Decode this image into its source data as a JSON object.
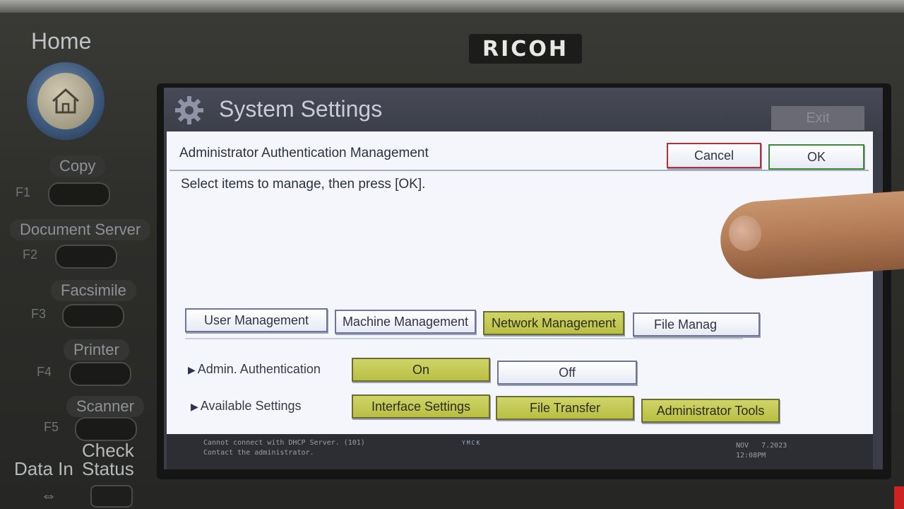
{
  "device": {
    "brand": "RICOH",
    "home_label": "Home",
    "modes": [
      {
        "label": "Copy",
        "fkey": "F1"
      },
      {
        "label": "Document Server",
        "fkey": "F2"
      },
      {
        "label": "Facsimile",
        "fkey": "F3"
      },
      {
        "label": "Printer",
        "fkey": "F4"
      },
      {
        "label": "Scanner",
        "fkey": "F5"
      }
    ],
    "data_in_label": "Data In",
    "check_status_label": "Check Status"
  },
  "screen": {
    "title": "System Settings",
    "exit_label": "Exit",
    "panel_title": "Administrator Authentication Management",
    "cancel_label": "Cancel",
    "ok_label": "OK",
    "instruction": "Select items to manage, then press [OK].",
    "tabs": [
      {
        "label": "User Management",
        "selected": false
      },
      {
        "label": "Machine Management",
        "selected": false
      },
      {
        "label": "Network Management",
        "selected": true
      },
      {
        "label": "File Manag",
        "selected": false
      }
    ],
    "admin_auth": {
      "label": "Admin. Authentication",
      "on_label": "On",
      "off_label": "Off",
      "value": "On"
    },
    "available_settings": {
      "label": "Available Settings",
      "options": [
        {
          "label": "Interface Settings",
          "selected": true
        },
        {
          "label": "File Transfer",
          "selected": true
        },
        {
          "label": "Administrator Tools",
          "selected": true
        }
      ]
    },
    "status": {
      "message_line1": "Cannot connect with DHCP Server. (101)",
      "message_line2": "Contact the administrator.",
      "toner_letters": [
        "Y",
        "M",
        "C",
        "K"
      ],
      "date": "NOV   7.2023",
      "time": "12:08PM"
    }
  },
  "colors": {
    "selected_button": "#c4c956",
    "cancel_border": "#b1303e",
    "ok_border": "#3b8a3a",
    "panel_bg": "#f4f6fb"
  }
}
